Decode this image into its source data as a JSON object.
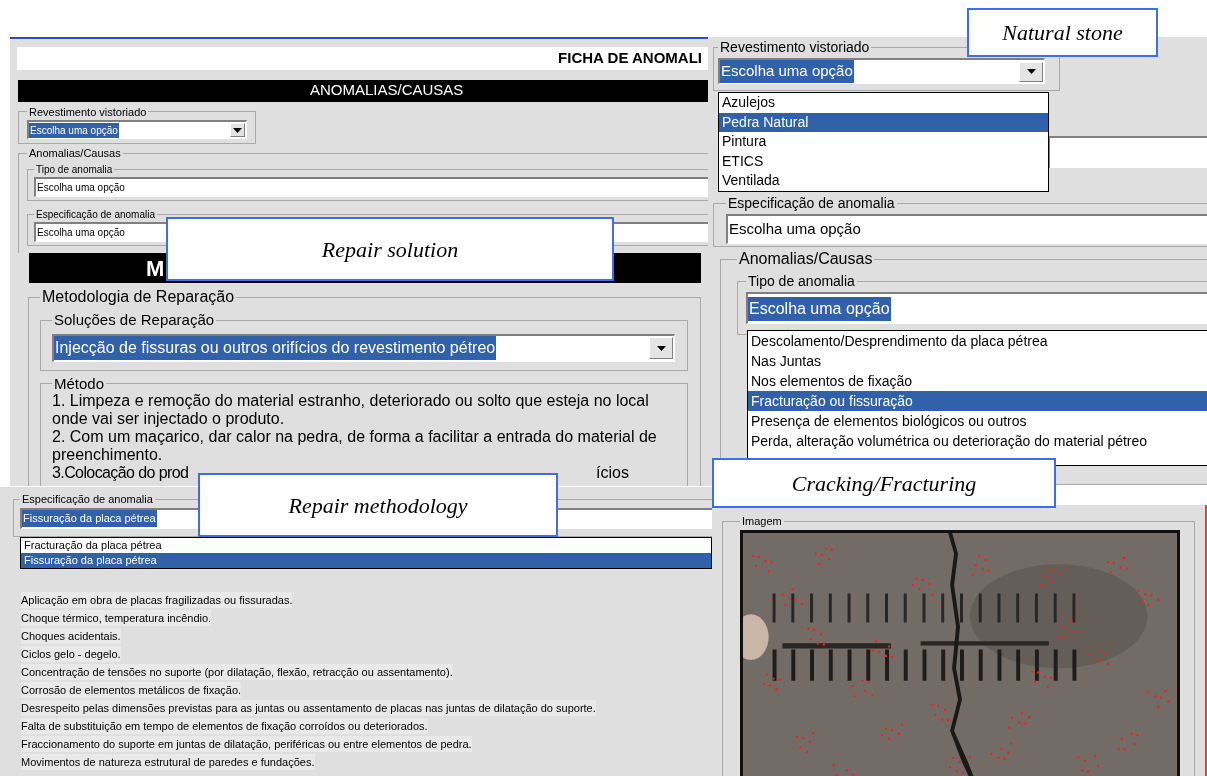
{
  "form_panel": {
    "title": "FICHA DE ANOMALI",
    "section_header": "ANOMALIAS/CAUSAS",
    "revestimento": {
      "label": "Revestimento vistoriado",
      "value": "Escolha uma opção",
      "value_highlighted": true
    },
    "group_label": "Anomalias/Causas",
    "tipo": {
      "label": "Tipo de anomalia",
      "value": "Escolha uma opção",
      "value_highlighted": false
    },
    "especificacao": {
      "label": "Especificação de anomalia",
      "value": "Escolha uma opção",
      "value_highlighted": false
    }
  },
  "repair_panel": {
    "header": "M",
    "group_label": "Metodologia de Reparação",
    "solutions": {
      "label": "Soluções de Reparação",
      "value": "Injecção de fissuras ou outros orifícios do revestimento pétreo",
      "value_highlighted": true
    },
    "method": {
      "label": "Método",
      "steps": [
        "1. Limpeza e remoção do material estranho, deteriorado ou solto que esteja no local onde vai ser injectado o produto.",
        "2. Com um maçarico, dar calor na pedra, de forma a facilitar a entrada do material de preenchimento."
      ],
      "partial_start": "3.Colocação do prod",
      "partial_end": "ícios"
    }
  },
  "spec_panel": {
    "label": "Especificação de anomalia",
    "value": "Fissuração da placa pétrea",
    "value_highlighted": true,
    "options": [
      {
        "label": "Fracturação da placa pétrea",
        "selected": false
      },
      {
        "label": "Fissuração da placa pétrea",
        "selected": true
      }
    ],
    "causes": [
      "Aplicação em obra de placas fragilizadas ou fissuradas.",
      "Choque térmico, temperatura incêndio.",
      "Choques acidentais.",
      "Ciclos gelo - degelo.",
      "Concentração de tensões no suporte (por dilatação, flexão, retracção ou assentamento).",
      "Corrosão de elementos metálicos de fixação.",
      "Desrespeito pelas dimensões previstas para as juntas ou assentamento de placas nas juntas de dilatação do suporte.",
      "Falta de substituição em tempo de elementos de fixação corroídos ou deteriorados.",
      "Fraccionamento do suporte em juntas de dilatação, periféricas ou entre elementos de pedra.",
      "Movimentos de natureza estrutural de paredes e fundações."
    ]
  },
  "type_panel": {
    "revestimento": {
      "label": "Revestimento vistoriado",
      "value": "Escolha uma opção",
      "value_highlighted": true,
      "options": [
        {
          "label": "Azulejos",
          "selected": false
        },
        {
          "label": "Pedra Natural",
          "selected": true
        },
        {
          "label": "Pintura",
          "selected": false
        },
        {
          "label": "ETICS",
          "selected": false
        },
        {
          "label": "Ventilada",
          "selected": false
        }
      ]
    },
    "especificacao": {
      "label": "Especificação de anomalia",
      "value": "Escolha uma opção",
      "value_highlighted": false
    },
    "group_label": "Anomalias/Causas",
    "tipo": {
      "label": "Tipo de anomalia",
      "value": "Escolha uma opção",
      "value_highlighted": true,
      "options": [
        {
          "label": "Descolamento/Desprendimento da placa pétrea",
          "selected": false
        },
        {
          "label": "Nas Juntas",
          "selected": false
        },
        {
          "label": "Nos elementos de fixação",
          "selected": false
        },
        {
          "label": "Fracturação ou fissuração",
          "selected": true
        },
        {
          "label": "Presença de elementos biológicos ou outros",
          "selected": false
        },
        {
          "label": "Perda, alteração volumétrica ou deterioração do material pétreo",
          "selected": false
        }
      ]
    }
  },
  "image_panel": {
    "label": "Imagem"
  },
  "callouts": [
    {
      "text": "Natural stone"
    },
    {
      "text": "Repair solution"
    },
    {
      "text": "Repair methodology"
    },
    {
      "text": "Cracking/Fracturing"
    }
  ]
}
